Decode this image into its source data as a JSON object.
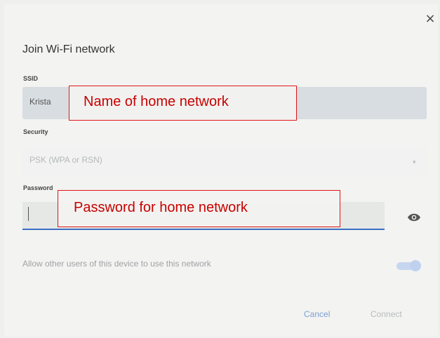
{
  "dialog": {
    "title": "Join Wi-Fi network",
    "close_symbol": "×"
  },
  "ssid": {
    "label": "SSID",
    "value": "Krista"
  },
  "security": {
    "label": "Security",
    "value": "PSK (WPA or RSN)",
    "chevron": "▾"
  },
  "password": {
    "label": "Password",
    "value": "",
    "icon": "eye-icon"
  },
  "share_option": {
    "label": "Allow other users of this device to use this network",
    "enabled": true
  },
  "buttons": {
    "cancel": "Cancel",
    "connect": "Connect"
  },
  "annotations": {
    "ssid_note": "Name of home network",
    "password_note": "Password for home network"
  },
  "colors": {
    "accent": "#3b6fc4",
    "annotation": "#e01515"
  }
}
